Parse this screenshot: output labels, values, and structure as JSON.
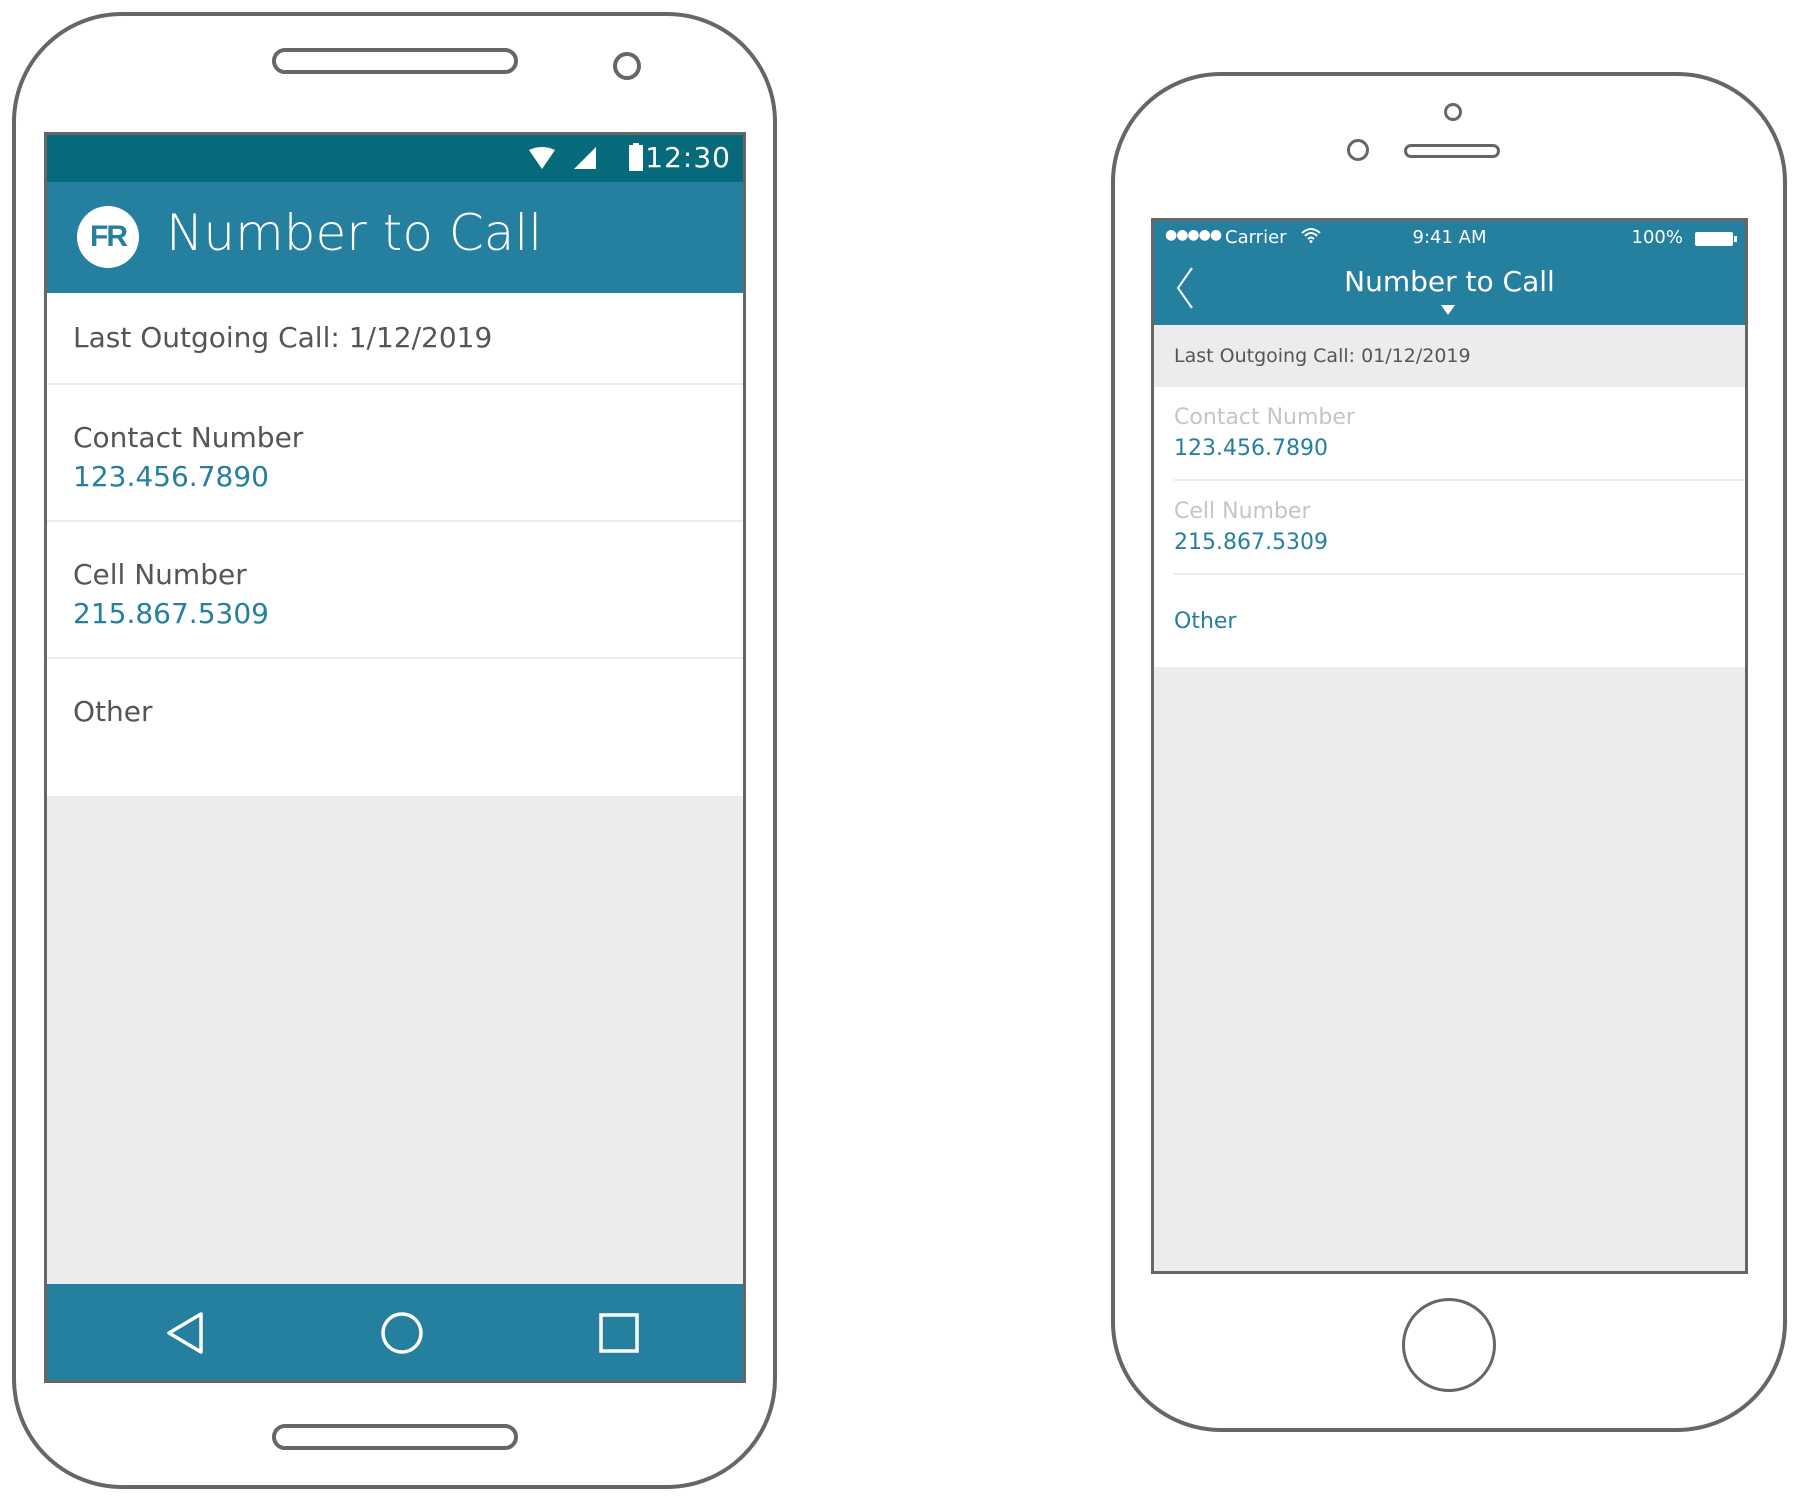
{
  "colors": {
    "primary": "#257f9e",
    "status_bar_android": "#066a7a",
    "link_text": "#257f9e",
    "background_grey": "#ececec",
    "frame_stroke": "#666666"
  },
  "android": {
    "status_bar": {
      "icons": [
        "wifi-icon",
        "cellular-signal-icon",
        "battery-icon"
      ],
      "time": "12:30"
    },
    "app_bar": {
      "logo_text": "FR",
      "title": "Number to Call"
    },
    "last_outgoing_call": "Last Outgoing Call: 1/12/2019",
    "options": [
      {
        "label": "Contact Number",
        "value": "123.456.7890"
      },
      {
        "label": "Cell Number",
        "value": "215.867.5309"
      },
      {
        "label": "Other",
        "value": ""
      }
    ],
    "nav_bar": {
      "icons": [
        "back-triangle-icon",
        "home-circle-icon",
        "recents-square-icon"
      ]
    }
  },
  "ios": {
    "status_bar": {
      "signal": "●●●●●",
      "carrier": "Carrier",
      "wifi_icon": "wifi-icon",
      "time": "9:41 AM",
      "battery_percent": "100%"
    },
    "nav_bar": {
      "back_icon": "chevron-left-icon",
      "title": "Number to Call",
      "dropdown_icon": "caret-down-icon"
    },
    "last_outgoing_call": "Last Outgoing Call: 01/12/2019",
    "options": [
      {
        "label": "Contact Number",
        "value": "123.456.7890"
      },
      {
        "label": "Cell Number",
        "value": "215.867.5309"
      },
      {
        "label": "Other",
        "value": ""
      }
    ]
  }
}
